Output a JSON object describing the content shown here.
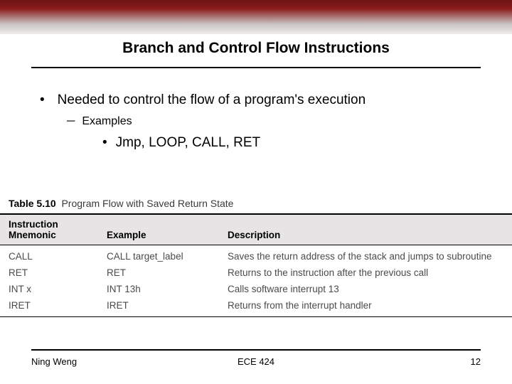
{
  "slide": {
    "title": "Branch and Control Flow Instructions",
    "bullet1": "Needed to control the flow of a program's execution",
    "bullet2": "Examples",
    "bullet3": "Jmp, LOOP, CALL, RET"
  },
  "table": {
    "caption_num": "Table 5.10",
    "caption_text": "Program Flow with Saved Return State",
    "headers": {
      "col1a": "Instruction",
      "col1b": "Mnemonic",
      "col2": "Example",
      "col3": "Description"
    },
    "rows": [
      {
        "mnemonic": "CALL",
        "example": "CALL target_label",
        "desc": "Saves the return address of the stack and jumps to subroutine"
      },
      {
        "mnemonic": "RET",
        "example": "RET",
        "desc": "Returns to the instruction after the previous call"
      },
      {
        "mnemonic": "INT x",
        "example": "INT 13h",
        "desc": "Calls software interrupt 13"
      },
      {
        "mnemonic": "IRET",
        "example": "IRET",
        "desc": "Returns from the interrupt handler"
      }
    ]
  },
  "footer": {
    "author": "Ning Weng",
    "course": "ECE 424",
    "page": "12"
  }
}
